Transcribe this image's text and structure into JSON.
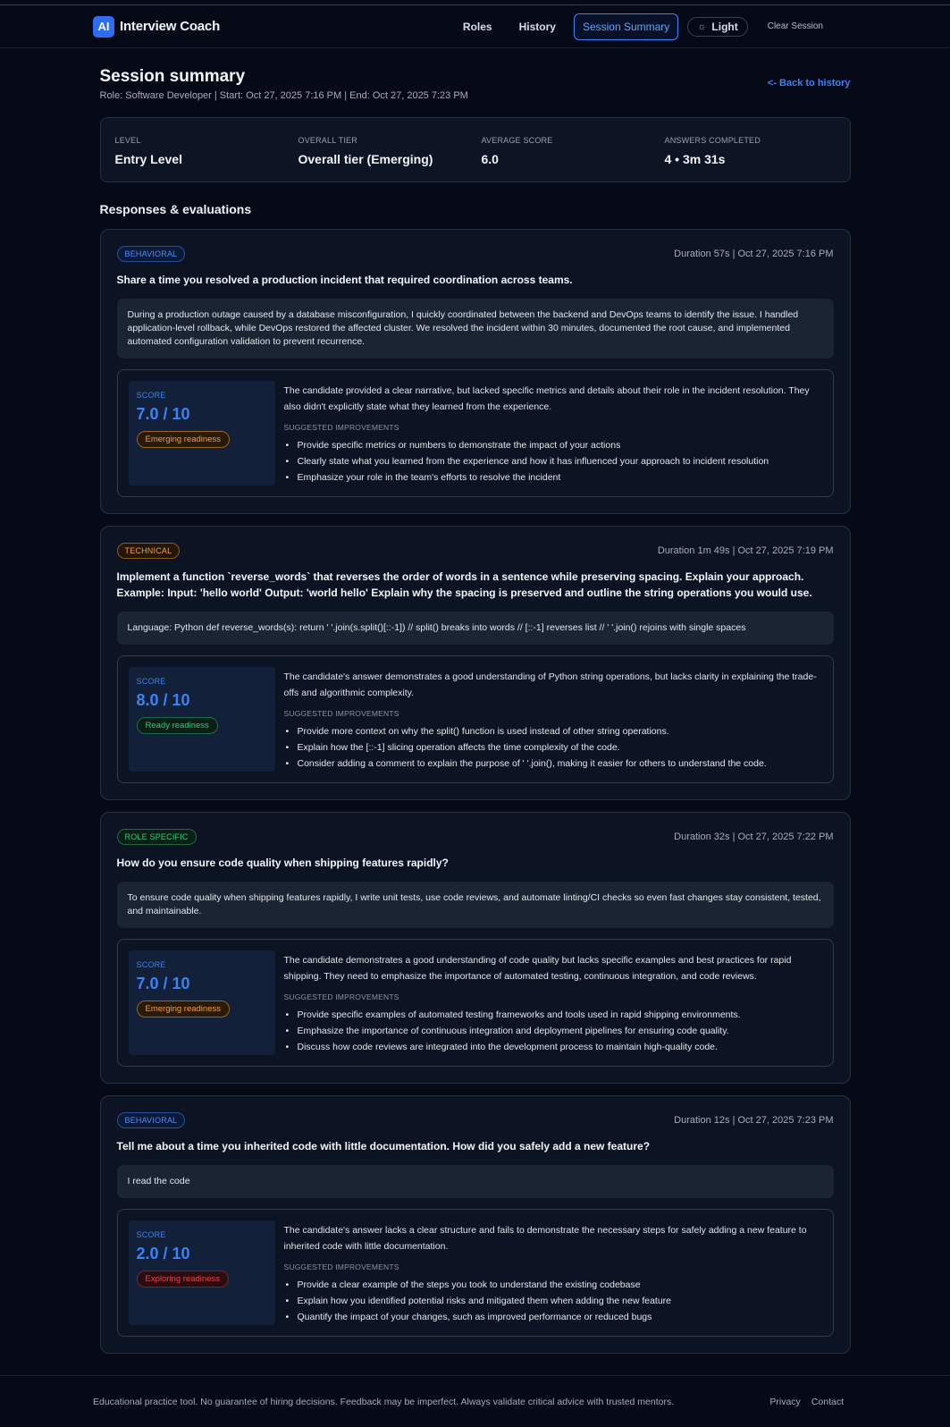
{
  "app": {
    "logo_text": "AI",
    "name": "Interview Coach"
  },
  "nav": {
    "roles": "Roles",
    "history": "History",
    "session_summary": "Session Summary",
    "theme": "Light",
    "clear": "Clear Session"
  },
  "summary": {
    "title": "Session summary",
    "meta": "Role: Software Developer | Start: Oct 27, 2025 7:16 PM | End: Oct 27, 2025 7:23 PM",
    "back": "<- Back to history",
    "stats": [
      {
        "label": "LEVEL",
        "value": "Entry Level"
      },
      {
        "label": "OVERALL TIER",
        "value": "Overall tier (Emerging)"
      },
      {
        "label": "AVERAGE SCORE",
        "value": "6.0"
      },
      {
        "label": "ANSWERS COMPLETED",
        "value": "4 • 3m 31s"
      }
    ]
  },
  "responses": {
    "title": "Responses & evaluations",
    "score_label": "SCORE",
    "improvements_label": "SUGGESTED IMPROVEMENTS",
    "items": [
      {
        "type": "BEHAVIORAL",
        "type_color": "blue",
        "duration": "Duration 57s | Oct 27, 2025 7:16 PM",
        "question": "Share a time you resolved a production incident that required coordination across teams.",
        "answer": "During a production outage caused by a database misconfiguration, I quickly coordinated between the backend and DevOps teams to identify the issue. I handled application-level rollback, while DevOps restored the affected cluster. We resolved the incident within 30 minutes, documented the root cause, and implemented automated configuration validation to prevent recurrence.",
        "score": "7.0 / 10",
        "readiness": "Emerging readiness",
        "readiness_color": "orange",
        "feedback": "The candidate provided a clear narrative, but lacked specific metrics and details about their role in the incident resolution. They also didn't explicitly state what they learned from the experience.",
        "improvements": [
          "Provide specific metrics or numbers to demonstrate the impact of your actions",
          "Clearly state what you learned from the experience and how it has influenced your approach to incident resolution",
          "Emphasize your role in the team's efforts to resolve the incident"
        ]
      },
      {
        "type": "TECHNICAL",
        "type_color": "orange",
        "duration": "Duration 1m 49s | Oct 27, 2025 7:19 PM",
        "question": "Implement a function `reverse_words` that reverses the order of words in a sentence while preserving spacing. Explain your approach. Example: Input: 'hello world' Output: 'world hello' Explain why the spacing is preserved and outline the string operations you would use.",
        "answer": "Language: Python def reverse_words(s): return ' '.join(s.split()[::-1]) // split() breaks into words // [::-1] reverses list // ' '.join() rejoins with single spaces",
        "score": "8.0 / 10",
        "readiness": "Ready readiness",
        "readiness_color": "green",
        "feedback": "The candidate's answer demonstrates a good understanding of Python string operations, but lacks clarity in explaining the trade-offs and algorithmic complexity.",
        "improvements": [
          "Provide more context on why the split() function is used instead of other string operations.",
          "Explain how the [::-1] slicing operation affects the time complexity of the code.",
          "Consider adding a comment to explain the purpose of ' '.join(), making it easier for others to understand the code."
        ]
      },
      {
        "type": "ROLE SPECIFIC",
        "type_color": "green",
        "duration": "Duration 32s | Oct 27, 2025 7:22 PM",
        "question": "How do you ensure code quality when shipping features rapidly?",
        "answer": "To ensure code quality when shipping features rapidly, I write unit tests, use code reviews, and automate linting/CI checks so even fast changes stay consistent, tested, and maintainable.",
        "score": "7.0 / 10",
        "readiness": "Emerging readiness",
        "readiness_color": "orange",
        "feedback": "The candidate demonstrates a good understanding of code quality but lacks specific examples and best practices for rapid shipping. They need to emphasize the importance of automated testing, continuous integration, and code reviews.",
        "improvements": [
          "Provide specific examples of automated testing frameworks and tools used in rapid shipping environments.",
          "Emphasize the importance of continuous integration and deployment pipelines for ensuring code quality.",
          "Discuss how code reviews are integrated into the development process to maintain high-quality code."
        ]
      },
      {
        "type": "BEHAVIORAL",
        "type_color": "blue",
        "duration": "Duration 12s | Oct 27, 2025 7:23 PM",
        "question": "Tell me about a time you inherited code with little documentation. How did you safely add a new feature?",
        "answer": "I read the code",
        "score": "2.0 / 10",
        "readiness": "Exploring readiness",
        "readiness_color": "red",
        "feedback": "The candidate's answer lacks a clear structure and fails to demonstrate the necessary steps for safely adding a new feature to inherited code with little documentation.",
        "improvements": [
          "Provide a clear example of the steps you took to understand the existing codebase",
          "Explain how you identified potential risks and mitigated them when adding the new feature",
          "Quantify the impact of your changes, such as improved performance or reduced bugs"
        ]
      }
    ]
  },
  "footer": {
    "disclaimer": "Educational practice tool. No guarantee of hiring decisions. Feedback may be imperfect. Always validate critical advice with trusted mentors.",
    "privacy": "Privacy",
    "contact": "Contact"
  }
}
